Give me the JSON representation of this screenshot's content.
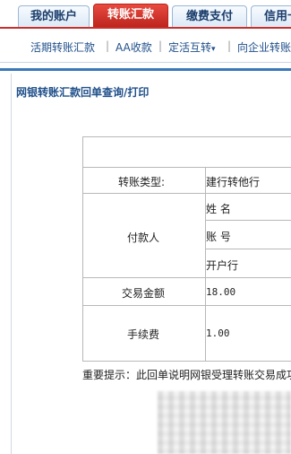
{
  "tabs": [
    {
      "label": "我的账户",
      "active": false
    },
    {
      "label": "转账汇款",
      "active": true
    },
    {
      "label": "缴费支付",
      "active": false
    },
    {
      "label": "信用卡",
      "active": false
    }
  ],
  "submenu": {
    "items": [
      "活期转账汇款",
      "AA收款",
      "定活互转",
      "向企业转账"
    ],
    "separator": "|",
    "dropdown_glyph": "▾"
  },
  "page_title": "网银转账汇款回单查询/打印",
  "receipt": {
    "transfer_type_label": "转账类型:",
    "transfer_type_value": "建行转他行",
    "payer_label": "付款人",
    "payer_name_label": "姓  名",
    "payer_account_label": "账  号",
    "payer_bank_label": "开户行",
    "amount_label": "交易金额",
    "amount_value": "18.00",
    "fee_label": "手续费",
    "fee_value": "1.00"
  },
  "notice": "重要提示：此回单说明网银受理转账交易成功",
  "colors": {
    "accent_red": "#c9302c",
    "link_blue": "#1f4f8a",
    "border_gray": "#b8b8b8"
  }
}
